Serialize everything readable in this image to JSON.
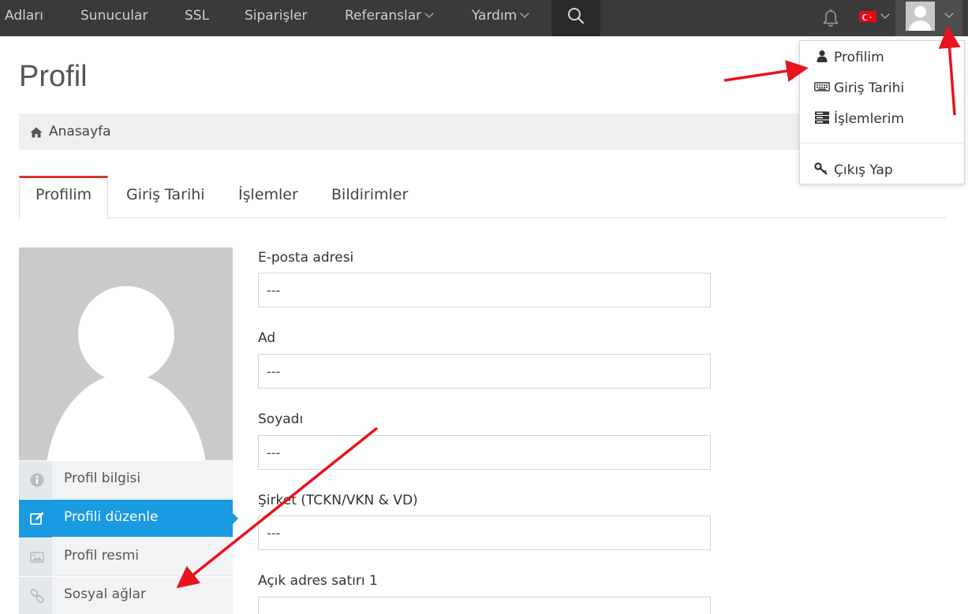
{
  "nav": {
    "items": [
      {
        "label": "Adları"
      },
      {
        "label": "Sunucular"
      },
      {
        "label": "SSL"
      },
      {
        "label": "Siparişler"
      },
      {
        "label": "Referanslar"
      },
      {
        "label": "Yardım"
      }
    ],
    "search_icon": "search-icon",
    "bell_icon": "bell-icon",
    "flag": "turkish-flag-icon",
    "avatar": "user-avatar"
  },
  "dropdown": {
    "items": [
      {
        "label": "Profilim",
        "icon": "user-icon"
      },
      {
        "label": "Giriş Tarihi",
        "icon": "keyboard-icon"
      },
      {
        "label": "İşlemlerim",
        "icon": "server-icon"
      },
      {
        "label": "Çıkış Yap",
        "icon": "key-icon"
      }
    ]
  },
  "page": {
    "title": "Profil",
    "breadcrumb": "Anasayfa"
  },
  "tabs": [
    {
      "label": "Profilim"
    },
    {
      "label": "Giriş Tarihi"
    },
    {
      "label": "İşlemler"
    },
    {
      "label": "Bildirimler"
    }
  ],
  "side_menu": [
    {
      "label": "Profil bilgisi",
      "icon": "info-icon"
    },
    {
      "label": "Profili düzenle",
      "icon": "edit-icon"
    },
    {
      "label": "Profil resmi",
      "icon": "image-icon"
    },
    {
      "label": "Sosyal ağlar",
      "icon": "link-icon"
    }
  ],
  "form": {
    "fields": [
      {
        "label": "E-posta adresi",
        "value": "---"
      },
      {
        "label": "Ad",
        "value": "---"
      },
      {
        "label": "Soyadı",
        "value": "---"
      },
      {
        "label": "Şirket (TCKN/VKN & VD)",
        "value": "---"
      },
      {
        "label": "Açık adres satırı 1",
        "value": ""
      }
    ]
  },
  "colors": {
    "nav_bg": "#3a3a3a",
    "accent_blue": "#1a9ae0",
    "tab_active_border": "#d9382c",
    "annotation_arrow": "#e8131c"
  }
}
